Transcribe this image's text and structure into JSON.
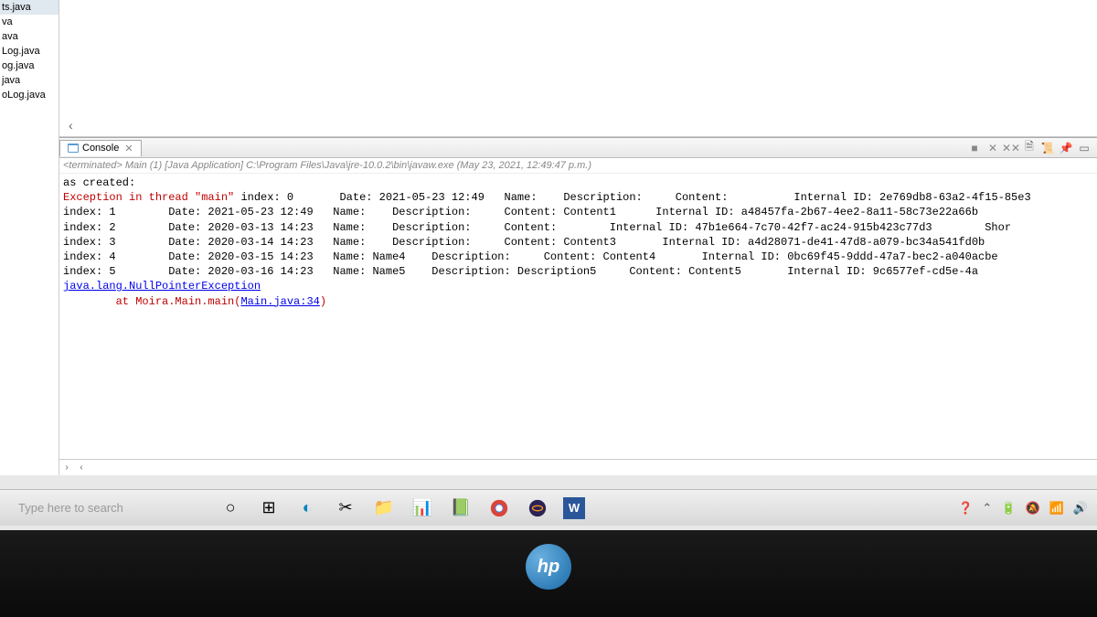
{
  "files": [
    "ts.java",
    "va",
    "ava",
    "Log.java",
    "og.java",
    "java",
    "oLog.java"
  ],
  "console": {
    "tab_label": "Console",
    "status": "<terminated> Main (1) [Java Application] C:\\Program Files\\Java\\jre-10.0.2\\bin\\javaw.exe (May 23, 2021, 12:49:47 p.m.)",
    "line_created": "as created:",
    "exception_prefix": "Exception in thread \"main\"",
    "rows": [
      {
        "index": "index: 0",
        "date": "Date: 2021-05-23 12:49",
        "name": "Name:",
        "desc": "Description:",
        "content": "Content:",
        "iid": "Internal ID: 2e769db8-63a2-4f15-85e3"
      },
      {
        "index": "index: 1",
        "date": "Date: 2021-05-23 12:49",
        "name": "Name:",
        "desc": "Description:",
        "content": "Content: Content1",
        "iid": "Internal ID: a48457fa-2b67-4ee2-8a11-58c73e22a66b"
      },
      {
        "index": "index: 2",
        "date": "Date: 2020-03-13 14:23",
        "name": "Name:",
        "desc": "Description:",
        "content": "Content:",
        "iid": "Internal ID: 47b1e664-7c70-42f7-ac24-915b423c77d3",
        "extra": "Shor"
      },
      {
        "index": "index: 3",
        "date": "Date: 2020-03-14 14:23",
        "name": "Name:",
        "desc": "Description:",
        "content": "Content: Content3",
        "iid": "Internal ID: a4d28071-de41-47d8-a079-bc34a541fd0b"
      },
      {
        "index": "index: 4",
        "date": "Date: 2020-03-15 14:23",
        "name": "Name: Name4",
        "desc": "Description:",
        "content": "Content: Content4",
        "iid": "Internal ID: 0bc69f45-9ddd-47a7-bec2-a040acbe"
      },
      {
        "index": "index: 5",
        "date": "Date: 2020-03-16 14:23",
        "name": "Name: Name5",
        "desc": "Description: Description5",
        "content": "Content: Content5",
        "iid": "Internal ID: 9c6577ef-cd5e-4a"
      }
    ],
    "npe": "java.lang.NullPointerException",
    "at_prefix": "at Moira.Main.main(",
    "at_link": "Main.java:34",
    "at_suffix": ")"
  },
  "taskbar": {
    "search_placeholder": "Type here to search"
  },
  "hp": "hp"
}
